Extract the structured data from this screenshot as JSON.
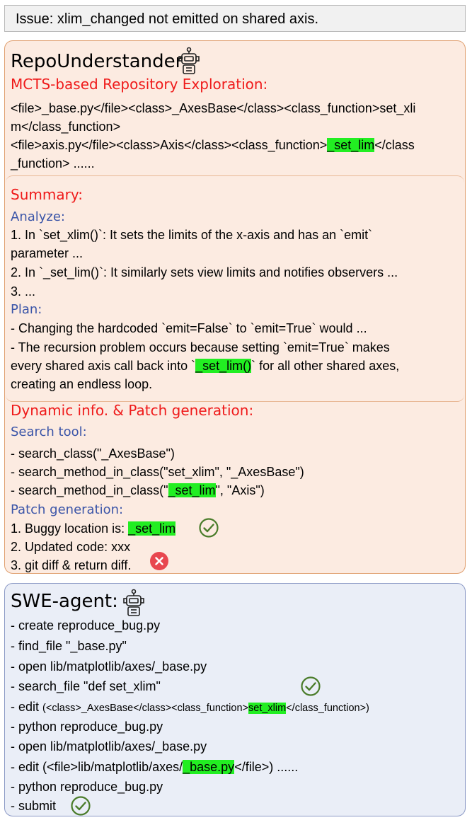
{
  "issue": "Issue: xlim_changed not emitted on shared axis.",
  "repo": {
    "title": "RepoUnderstander",
    "mcts_title": "MCTS-based Repository Exploration:",
    "path_l1": "<file>_base.py</file><class>_AxesBase</class><class_function>set_xli",
    "path_l2": "m</class_function>",
    "path_l3a": "<file>axis.py</file><class>Axis</class><class_function>",
    "path_l3b": "_set_lim",
    "path_l3c": "</class",
    "path_l4": "_function> ......",
    "summary_title": "Summary:",
    "analyze_title": "Analyze:",
    "analyze_1a": "1. In `set_xlim()`: It sets the limits of the x-axis and has an `emit`",
    "analyze_1b": "parameter ...",
    "analyze_2": "2. In `_set_lim()`: It similarly sets view limits and notifies observers ...",
    "analyze_3": "3. ...",
    "plan_title": "Plan:",
    "plan_1": "- Changing the hardcoded `emit=False` to `emit=True` would ...",
    "plan_2a": "- The recursion problem occurs because setting `emit=True` makes",
    "plan_2b_pre": "every shared axis call back into `",
    "plan_2b_hl": "_set_lim()",
    "plan_2b_post": "` for all other shared axes,",
    "plan_2c": "creating an endless loop.",
    "dyn_title": "Dynamic info. & Patch generation:",
    "search_title": "Search tool:",
    "search_1": "- search_class(\"_AxesBase\")",
    "search_2": "- search_method_in_class(\"set_xlim\", \"_AxesBase\")",
    "search_3_pre": "- search_method_in_class(\"",
    "search_3_hl": "_set_lim",
    "search_3_post": "\", \"Axis\")",
    "patch_title": "Patch generation:",
    "patch_1_pre": "1. Buggy location is: ",
    "patch_1_hl": "_set_lim",
    "patch_2": "2. Updated code: xxx",
    "patch_3": "3. git diff & return diff."
  },
  "swe": {
    "title": "SWE-agent:",
    "s1": "- create reproduce_bug.py",
    "s2": "- find_file \"_base.py\"",
    "s3": "- open lib/matplotlib/axes/_base.py",
    "s4": "- search_file \"def set_xlim\"",
    "s5_pre": "- edit ",
    "s5_small_pre": "(<class>_AxesBase</class><class_function>",
    "s5_hl": "set_xlim",
    "s5_small_post": "</class_function>)",
    "s6": "- python reproduce_bug.py",
    "s7": "- open lib/matplotlib/axes/_base.py",
    "s8_pre": "- edit  (<file>lib/matplotlib/axes/",
    "s8_hl": "_base.py",
    "s8_post": "</file>) ......",
    "s9": "- python reproduce_bug.py",
    "s10": "- submit"
  },
  "colors": {
    "highlight": "#22ee22",
    "red_heading": "#ef1a1a",
    "blue_heading": "#3b55a8",
    "check": "#4a7c2a",
    "cross": "#e8474f"
  }
}
